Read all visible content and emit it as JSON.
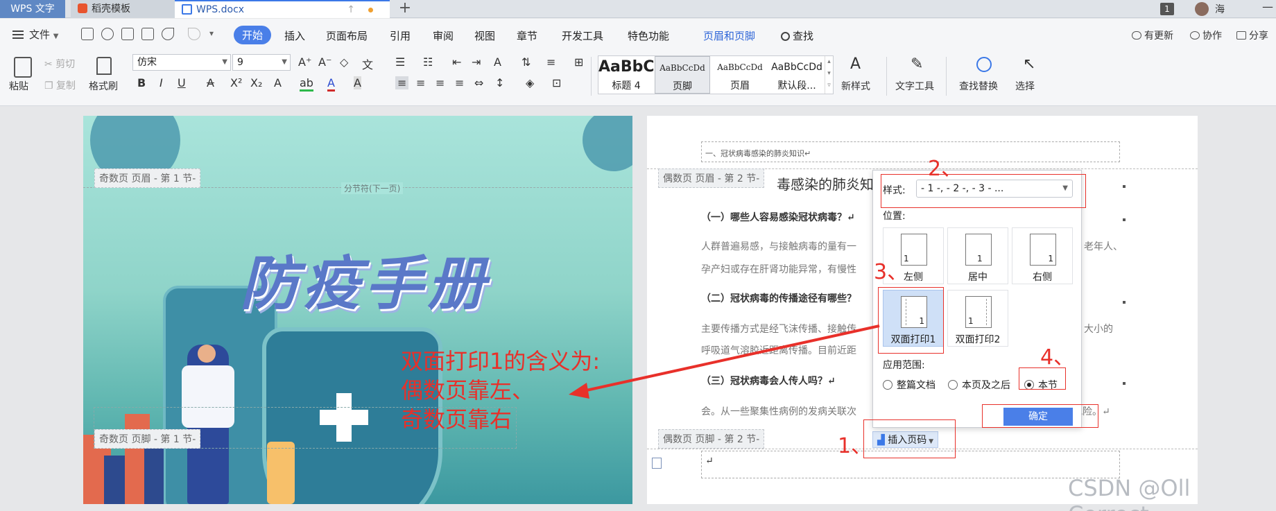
{
  "tabs": {
    "app": "WPS 文字",
    "docer": "稻壳模板",
    "doc": "WPS.docx"
  },
  "topbar": {
    "badge": "1",
    "user": "海",
    "minimize": "—"
  },
  "menu": {
    "file": "文件",
    "tabs": [
      "开始",
      "插入",
      "页面布局",
      "引用",
      "审阅",
      "视图",
      "章节",
      "开发工具",
      "特色功能"
    ],
    "context_tab": "页眉和页脚",
    "search": "查找",
    "update": "有更新",
    "collab": "协作",
    "share": "分享"
  },
  "ribbon": {
    "paste": "粘贴",
    "cut": "剪切",
    "copy": "复制",
    "format_painter": "格式刷",
    "font": "仿宋",
    "size": "9",
    "styles": [
      {
        "sample": "AaBbC",
        "name": "标题 4"
      },
      {
        "sample": "AaBbCcDd",
        "name": "页脚"
      },
      {
        "sample": "AaBbCcDd",
        "name": "页眉"
      },
      {
        "sample": "AaBbCcDd",
        "name": "默认段..."
      }
    ],
    "new_style": "新样式",
    "text_tools": "文字工具",
    "find_replace": "查找替换",
    "select": "选择"
  },
  "page_left": {
    "header_tag": "奇数页 页眉 - 第 1 节-",
    "section_break": "分节符(下一页)",
    "title": "防疫手册",
    "footer_tag": "奇数页 页脚 - 第 1 节-"
  },
  "annotation": [
    "双面打印1的含义为:",
    "偶数页靠左、",
    "奇数页靠右"
  ],
  "page_right": {
    "header_text": "一、冠状病毒感染的肺炎知识↵",
    "header_tag": "偶数页 页眉 - 第 2 节-",
    "heading": "毒感染的肺炎知",
    "q1": "（一）哪些人容易感染冠状病毒？↵",
    "p1a": "人群普遍易感，与接触病毒的量有一",
    "p1b": "孕产妇或存在肝肾功能异常，有慢性",
    "p1c": "老年人、",
    "q2": "（二）冠状病毒的传播途径有哪些？",
    "p2a": "主要传播方式是经飞沫传播、接触传",
    "p2b": "呼吸道气溶胶近距离传播。目前近距",
    "p2c": "大小的",
    "q3": "（三）冠状病毒会人传人吗？↵",
    "p3a": "会。从一些聚集性病例的发病关联次",
    "p3b": "播风险。↵",
    "footer_tag": "偶数页 页脚 - 第 2 节-",
    "footer_mark": "↵",
    "insert_page_number": "插入页码"
  },
  "dialog": {
    "style_label": "样式:",
    "style_value": "- 1 -, - 2 -, - 3 - ...",
    "position_label": "位置:",
    "positions": [
      "左侧",
      "居中",
      "右侧",
      "双面打印1",
      "双面打印2"
    ],
    "scope_label": "应用范围:",
    "scopes": [
      "整篇文档",
      "本页及之后",
      "本节"
    ],
    "ok": "确定"
  },
  "steps": [
    "1、",
    "2、",
    "3、",
    "4、"
  ],
  "watermark": "CSDN @Oll Correct",
  "colors": {
    "accent": "#4a7fe8",
    "annotation_red": "#e8302a",
    "selected_option": "#cfe0f7"
  }
}
